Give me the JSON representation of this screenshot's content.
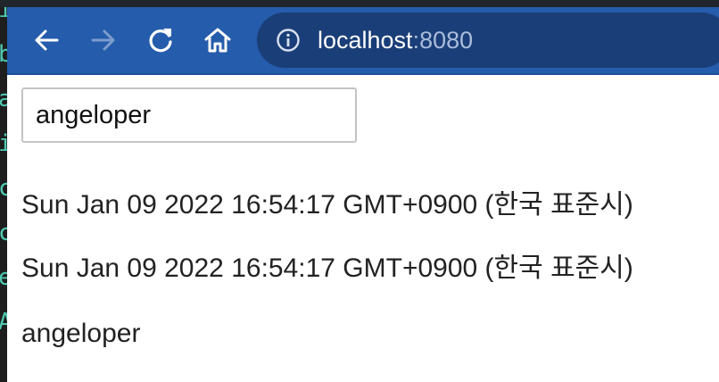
{
  "browser": {
    "url_host": "localhost",
    "url_port": ":8080",
    "icons": {
      "back": "back-arrow-icon",
      "forward": "forward-arrow-icon",
      "reload": "reload-icon",
      "home": "home-icon",
      "info": "info-icon"
    },
    "colors": {
      "toolbar": "#255cac",
      "address_bar": "#1a3e78"
    }
  },
  "page": {
    "input_value": "angeloper",
    "date_line_1": "Sun Jan 09 2022 16:54:17 GMT+0900 (한국 표준시)",
    "date_line_2": "Sun Jan 09 2022 16:54:17 GMT+0900 (한국 표준시)",
    "name_output": "angeloper"
  },
  "left_edge": {
    "glyphs": [
      "i",
      "b",
      "a",
      "i",
      "c",
      "c",
      "e",
      "A"
    ]
  }
}
